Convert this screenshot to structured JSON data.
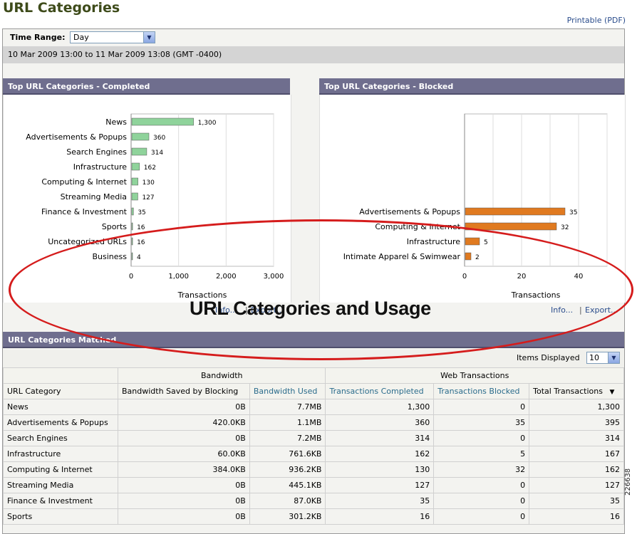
{
  "page": {
    "title": "URL Categories",
    "printable_label": "Printable (PDF)"
  },
  "time_range": {
    "label": "Time Range:",
    "value": "Day",
    "date_span": "10 Mar 2009 13:00 to 11 Mar 2009 13:08 (GMT -0400)"
  },
  "completed_chart": {
    "header": "Top URL Categories - Completed",
    "categories": [
      "News",
      "Advertisements & Popups",
      "Search Engines",
      "Infrastructure",
      "Computing & Internet",
      "Streaming Media",
      "Finance & Investment",
      "Sports",
      "Uncategorized URLs",
      "Business"
    ],
    "values": [
      1300,
      360,
      314,
      162,
      130,
      127,
      35,
      16,
      16,
      4
    ],
    "value_labels": [
      "1,300",
      "360",
      "314",
      "162",
      "130",
      "127",
      "35",
      "16",
      "16",
      "4"
    ],
    "xticks": [
      "0",
      "1,000",
      "2,000",
      "3,000"
    ],
    "xmax": 3000,
    "xlabel": "Transactions",
    "color": "#8fd39b",
    "info_link": "Info...",
    "export_link": "Export..."
  },
  "blocked_chart": {
    "header": "Top URL Categories - Blocked",
    "categories": [
      "Advertisements & Popups",
      "Computing & Internet",
      "Infrastructure",
      "Intimate Apparel & Swimwear"
    ],
    "values": [
      35,
      32,
      5,
      2
    ],
    "value_labels": [
      "35",
      "32",
      "5",
      "2"
    ],
    "xticks": [
      "0",
      "20",
      "40"
    ],
    "xmax": 50,
    "xlabel": "Transactions",
    "color": "#e07a20",
    "info_link": "Info...",
    "export_link": "Export..."
  },
  "annotation": {
    "text": "URL Categories and Usage",
    "figure_id": "226638"
  },
  "matched": {
    "header": "URL Categories Matched",
    "items_label": "Items Displayed",
    "items_value": "10",
    "group_bandwidth": "Bandwidth",
    "group_web": "Web Transactions",
    "columns": [
      "URL Category",
      "Bandwidth Saved by Blocking",
      "Bandwidth Used",
      "Transactions Completed",
      "Transactions Blocked",
      "Total Transactions"
    ],
    "sort_indicator": "▼",
    "rows": [
      [
        "News",
        "0B",
        "7.7MB",
        "1,300",
        "0",
        "1,300"
      ],
      [
        "Advertisements & Popups",
        "420.0KB",
        "1.1MB",
        "360",
        "35",
        "395"
      ],
      [
        "Search Engines",
        "0B",
        "7.2MB",
        "314",
        "0",
        "314"
      ],
      [
        "Infrastructure",
        "60.0KB",
        "761.6KB",
        "162",
        "5",
        "167"
      ],
      [
        "Computing & Internet",
        "384.0KB",
        "936.2KB",
        "130",
        "32",
        "162"
      ],
      [
        "Streaming Media",
        "0B",
        "445.1KB",
        "127",
        "0",
        "127"
      ],
      [
        "Finance & Investment",
        "0B",
        "87.0KB",
        "35",
        "0",
        "35"
      ],
      [
        "Sports",
        "0B",
        "301.2KB",
        "16",
        "0",
        "16"
      ]
    ]
  },
  "colors": {
    "header_bg": "#6f6e8e",
    "annotation_oval": "#d51c1c",
    "title": "#3e4b1a",
    "link": "#2b4d8c"
  }
}
